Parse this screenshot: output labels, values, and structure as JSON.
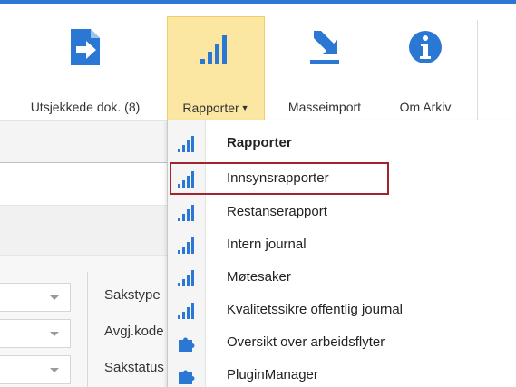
{
  "accent_color": "#2b78d4",
  "ribbon": {
    "buttons": [
      {
        "label": "Utsjekkede dok. (8)",
        "icon": "checkout-document-icon"
      },
      {
        "label": "Rapporter",
        "icon": "bar-chart-icon",
        "has_dropdown": true,
        "active": true
      },
      {
        "label": "Masseimport",
        "icon": "download-tray-icon"
      },
      {
        "label": "Om Arkiv",
        "icon": "info-icon"
      }
    ]
  },
  "form": {
    "labels": [
      "Sakstype",
      "Avgj.kode",
      "Sakstatus"
    ]
  },
  "menu": {
    "items": [
      {
        "label": "Rapporter",
        "icon": "bar-chart-icon",
        "header": true
      },
      {
        "label": "Innsynsrapporter",
        "icon": "bar-chart-icon",
        "highlighted": true
      },
      {
        "label": "Restanserapport",
        "icon": "bar-chart-icon"
      },
      {
        "label": "Intern journal",
        "icon": "bar-chart-icon"
      },
      {
        "label": "Møtesaker",
        "icon": "bar-chart-icon"
      },
      {
        "label": "Kvalitetssikre offentlig journal",
        "icon": "bar-chart-icon"
      },
      {
        "label": "Oversikt over arbeidsflyter",
        "icon": "puzzle-icon"
      },
      {
        "label": "PluginManager",
        "icon": "puzzle-icon"
      }
    ],
    "highlight_color": "#a3242f"
  }
}
